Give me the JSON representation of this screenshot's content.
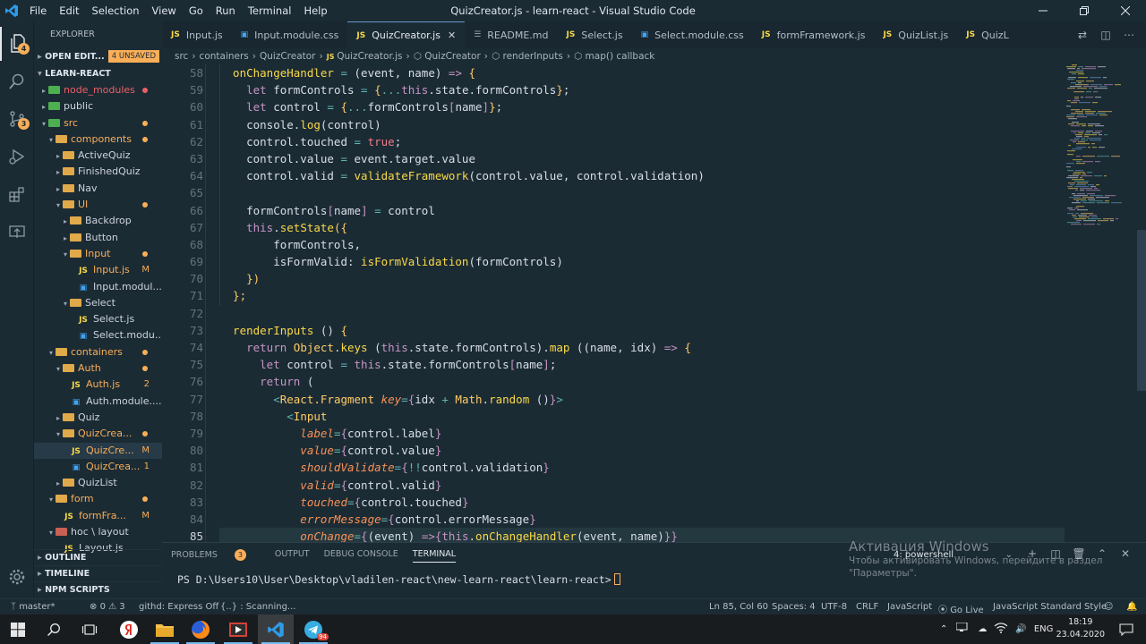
{
  "window": {
    "title": "QuizCreator.js - learn-react - Visual Studio Code",
    "menu": [
      "File",
      "Edit",
      "Selection",
      "View",
      "Go",
      "Run",
      "Terminal",
      "Help"
    ]
  },
  "activity": {
    "explorer_badge": "4",
    "scm_badge": "3"
  },
  "sidebar": {
    "header": "EXPLORER",
    "open_editors": "OPEN EDIT...",
    "unsaved": "4 UNSAVED",
    "project": "LEARN-REACT",
    "tree": [
      {
        "label": "node_modules",
        "depth": 1,
        "kind": "folder-green",
        "open": false,
        "color": "red",
        "dot": "red"
      },
      {
        "label": "public",
        "depth": 1,
        "kind": "folder-green",
        "open": false,
        "color": "plain",
        "dot": ""
      },
      {
        "label": "src",
        "depth": 1,
        "kind": "folder-green",
        "open": true,
        "color": "orange",
        "dot": "orange"
      },
      {
        "label": "components",
        "depth": 2,
        "kind": "folder",
        "open": true,
        "color": "orange",
        "dot": "orange"
      },
      {
        "label": "ActiveQuiz",
        "depth": 3,
        "kind": "folder",
        "open": false,
        "color": "plain",
        "dot": ""
      },
      {
        "label": "FinishedQuiz",
        "depth": 3,
        "kind": "folder",
        "open": false,
        "color": "plain",
        "dot": ""
      },
      {
        "label": "Nav",
        "depth": 3,
        "kind": "folder",
        "open": false,
        "color": "plain",
        "dot": ""
      },
      {
        "label": "UI",
        "depth": 3,
        "kind": "folder",
        "open": true,
        "color": "orange",
        "dot": "orange"
      },
      {
        "label": "Backdrop",
        "depth": 4,
        "kind": "folder",
        "open": false,
        "color": "plain",
        "dot": ""
      },
      {
        "label": "Button",
        "depth": 4,
        "kind": "folder",
        "open": false,
        "color": "plain",
        "dot": ""
      },
      {
        "label": "Input",
        "depth": 4,
        "kind": "folder",
        "open": true,
        "color": "orange",
        "dot": "orange"
      },
      {
        "label": "Input.js",
        "depth": 5,
        "kind": "js",
        "open": false,
        "color": "orange",
        "status": "M"
      },
      {
        "label": "Input.modul...",
        "depth": 5,
        "kind": "css",
        "open": false,
        "color": "plain",
        "dot": ""
      },
      {
        "label": "Select",
        "depth": 4,
        "kind": "folder",
        "open": true,
        "color": "plain",
        "dot": ""
      },
      {
        "label": "Select.js",
        "depth": 5,
        "kind": "js",
        "open": false,
        "color": "plain",
        "dot": ""
      },
      {
        "label": "Select.modu...",
        "depth": 5,
        "kind": "css",
        "open": false,
        "color": "plain",
        "dot": ""
      },
      {
        "label": "containers",
        "depth": 2,
        "kind": "folder",
        "open": true,
        "color": "orange",
        "dot": "orange"
      },
      {
        "label": "Auth",
        "depth": 3,
        "kind": "folder",
        "open": true,
        "color": "orange",
        "dot": "orange"
      },
      {
        "label": "Auth.js",
        "depth": 4,
        "kind": "js",
        "open": false,
        "color": "orange",
        "status": "2"
      },
      {
        "label": "Auth.module....",
        "depth": 4,
        "kind": "css",
        "open": false,
        "color": "plain",
        "dot": ""
      },
      {
        "label": "Quiz",
        "depth": 3,
        "kind": "folder",
        "open": false,
        "color": "plain",
        "dot": ""
      },
      {
        "label": "QuizCrea...",
        "depth": 3,
        "kind": "folder",
        "open": true,
        "color": "orange",
        "dot": "orange"
      },
      {
        "label": "QuizCre...",
        "depth": 4,
        "kind": "js",
        "open": false,
        "color": "orange",
        "status": "M",
        "selected": true
      },
      {
        "label": "QuizCrea...",
        "depth": 4,
        "kind": "css",
        "open": false,
        "color": "orange",
        "status": "1"
      },
      {
        "label": "QuizList",
        "depth": 3,
        "kind": "folder",
        "open": false,
        "color": "plain",
        "dot": ""
      },
      {
        "label": "form",
        "depth": 2,
        "kind": "folder",
        "open": true,
        "color": "orange",
        "dot": "orange"
      },
      {
        "label": "formFra...",
        "depth": 3,
        "kind": "js",
        "open": false,
        "color": "orange",
        "status": "M"
      },
      {
        "label": "hoc \\ layout",
        "depth": 2,
        "kind": "folder-red",
        "open": true,
        "color": "plain",
        "dot": ""
      },
      {
        "label": "Layout.js",
        "depth": 3,
        "kind": "js",
        "open": false,
        "color": "plain",
        "dot": ""
      }
    ],
    "bottom_sections": [
      "OUTLINE",
      "TIMELINE",
      "NPM SCRIPTS"
    ]
  },
  "tabs": [
    {
      "label": "Input.js",
      "kind": "js",
      "active": false
    },
    {
      "label": "Input.module.css",
      "kind": "css",
      "active": false
    },
    {
      "label": "QuizCreator.js",
      "kind": "js",
      "active": true
    },
    {
      "label": "README.md",
      "kind": "md",
      "active": false
    },
    {
      "label": "Select.js",
      "kind": "js",
      "active": false
    },
    {
      "label": "Select.module.css",
      "kind": "css",
      "active": false
    },
    {
      "label": "formFramework.js",
      "kind": "js",
      "active": false
    },
    {
      "label": "QuizList.js",
      "kind": "js",
      "active": false
    },
    {
      "label": "QuizL",
      "kind": "js",
      "active": false
    }
  ],
  "breadcrumb": [
    "src",
    "containers",
    "QuizCreator",
    "QuizCreator.js",
    "QuizCreator",
    "renderInputs",
    "map() callback"
  ],
  "code": {
    "current_line": 85,
    "lines": [
      {
        "n": 58,
        "t": [
          [
            "  onChangeHandler",
            "y"
          ],
          [
            " = ",
            "p"
          ],
          [
            "(",
            "w"
          ],
          [
            "event",
            "w"
          ],
          [
            ", ",
            "w"
          ],
          [
            "name",
            "w"
          ],
          [
            ")",
            "w"
          ],
          [
            " => ",
            "k"
          ],
          [
            "{",
            "o"
          ]
        ]
      },
      {
        "n": 59,
        "t": [
          [
            "    let ",
            "k"
          ],
          [
            "formControls",
            "w"
          ],
          [
            " = ",
            "p"
          ],
          [
            "{",
            "o"
          ],
          [
            "...",
            "p"
          ],
          [
            "this",
            "k"
          ],
          [
            ".state.formControls",
            "w"
          ],
          [
            "}",
            "o"
          ],
          [
            ";",
            "w"
          ]
        ]
      },
      {
        "n": 60,
        "t": [
          [
            "    let ",
            "k"
          ],
          [
            "control",
            "w"
          ],
          [
            " = ",
            "p"
          ],
          [
            "{",
            "o"
          ],
          [
            "...",
            "p"
          ],
          [
            "formControls",
            "w"
          ],
          [
            "[",
            "k"
          ],
          [
            "name",
            "w"
          ],
          [
            "]",
            "k"
          ],
          [
            "}",
            "o"
          ],
          [
            ";",
            "w"
          ]
        ]
      },
      {
        "n": 61,
        "t": [
          [
            "    console",
            "w"
          ],
          [
            ".",
            "w"
          ],
          [
            "log",
            "y"
          ],
          [
            "(",
            "w"
          ],
          [
            "control",
            "w"
          ],
          [
            ")",
            "w"
          ]
        ]
      },
      {
        "n": 62,
        "t": [
          [
            "    control.touched",
            "w"
          ],
          [
            " = ",
            "p"
          ],
          [
            "true",
            "b"
          ],
          [
            ";",
            "w"
          ]
        ]
      },
      {
        "n": 63,
        "t": [
          [
            "    control.value",
            "w"
          ],
          [
            " = ",
            "p"
          ],
          [
            "event.target.value",
            "w"
          ]
        ]
      },
      {
        "n": 64,
        "t": [
          [
            "    control.valid",
            "w"
          ],
          [
            " = ",
            "p"
          ],
          [
            "validateFramework",
            "y"
          ],
          [
            "(",
            "w"
          ],
          [
            "control.value, control.validation",
            "w"
          ],
          [
            ")",
            "w"
          ]
        ]
      },
      {
        "n": 65,
        "t": []
      },
      {
        "n": 66,
        "t": [
          [
            "    formControls",
            "w"
          ],
          [
            "[",
            "k"
          ],
          [
            "name",
            "w"
          ],
          [
            "]",
            "k"
          ],
          [
            " = ",
            "p"
          ],
          [
            "control",
            "w"
          ]
        ]
      },
      {
        "n": 67,
        "t": [
          [
            "    this",
            "k"
          ],
          [
            ".",
            "w"
          ],
          [
            "setState",
            "y"
          ],
          [
            "({",
            "o"
          ]
        ]
      },
      {
        "n": 68,
        "t": [
          [
            "        formControls,",
            "w"
          ]
        ]
      },
      {
        "n": 69,
        "t": [
          [
            "        isFormValid: ",
            "w"
          ],
          [
            "isFormValidation",
            "y"
          ],
          [
            "(",
            "w"
          ],
          [
            "formControls",
            "w"
          ],
          [
            ")",
            "w"
          ]
        ]
      },
      {
        "n": 70,
        "t": [
          [
            "    })",
            "o"
          ]
        ]
      },
      {
        "n": 71,
        "t": [
          [
            "  };",
            "o"
          ]
        ]
      },
      {
        "n": 72,
        "t": []
      },
      {
        "n": 73,
        "t": [
          [
            "  renderInputs",
            "y"
          ],
          [
            " () ",
            "w"
          ],
          [
            "{",
            "o"
          ]
        ]
      },
      {
        "n": 74,
        "t": [
          [
            "    return ",
            "k"
          ],
          [
            "Object",
            "o"
          ],
          [
            ".",
            "w"
          ],
          [
            "keys",
            "y"
          ],
          [
            " (",
            "w"
          ],
          [
            "this",
            "k"
          ],
          [
            ".state.formControls",
            ""
          ],
          [
            ").",
            "w"
          ],
          [
            "map",
            "y"
          ],
          [
            " ((",
            "w"
          ],
          [
            "name, idx",
            "w"
          ],
          [
            ") ",
            "w"
          ],
          [
            "=> ",
            "k"
          ],
          [
            "{",
            "o"
          ]
        ]
      },
      {
        "n": 75,
        "t": [
          [
            "      let ",
            "k"
          ],
          [
            "control",
            "w"
          ],
          [
            " = ",
            "p"
          ],
          [
            "this",
            "k"
          ],
          [
            ".state.formControls",
            "w"
          ],
          [
            "[",
            "k"
          ],
          [
            "name",
            "w"
          ],
          [
            "]",
            "k"
          ],
          [
            ";",
            "w"
          ]
        ]
      },
      {
        "n": 76,
        "t": [
          [
            "      return ",
            "k"
          ],
          [
            "(",
            "w"
          ]
        ]
      },
      {
        "n": 77,
        "t": [
          [
            "        <",
            "p"
          ],
          [
            "React.Fragment",
            "o"
          ],
          [
            " key",
            "a"
          ],
          [
            "=",
            "p"
          ],
          [
            "{",
            "k"
          ],
          [
            "idx",
            "w"
          ],
          [
            " + ",
            "p"
          ],
          [
            "Math",
            "o"
          ],
          [
            ".",
            "w"
          ],
          [
            "random",
            "y"
          ],
          [
            " ()",
            "w"
          ],
          [
            "}",
            "k"
          ],
          [
            ">",
            "p"
          ]
        ]
      },
      {
        "n": 78,
        "t": [
          [
            "          <",
            "p"
          ],
          [
            "Input",
            "o"
          ]
        ]
      },
      {
        "n": 79,
        "t": [
          [
            "            label",
            "a"
          ],
          [
            "=",
            "p"
          ],
          [
            "{",
            "k"
          ],
          [
            "control.label",
            "w"
          ],
          [
            "}",
            "k"
          ]
        ]
      },
      {
        "n": 80,
        "t": [
          [
            "            value",
            "a"
          ],
          [
            "=",
            "p"
          ],
          [
            "{",
            "k"
          ],
          [
            "control.value",
            "w"
          ],
          [
            "}",
            "k"
          ]
        ]
      },
      {
        "n": 81,
        "t": [
          [
            "            shouldValidate",
            "a"
          ],
          [
            "=",
            "p"
          ],
          [
            "{",
            "k"
          ],
          [
            "!!",
            "p"
          ],
          [
            "control.validation",
            "w"
          ],
          [
            "}",
            "k"
          ]
        ]
      },
      {
        "n": 82,
        "t": [
          [
            "            valid",
            "a"
          ],
          [
            "=",
            "p"
          ],
          [
            "{",
            "k"
          ],
          [
            "control.valid",
            "w"
          ],
          [
            "}",
            "k"
          ]
        ]
      },
      {
        "n": 83,
        "t": [
          [
            "            touched",
            "a"
          ],
          [
            "=",
            "p"
          ],
          [
            "{",
            "k"
          ],
          [
            "control.touched",
            "w"
          ],
          [
            "}",
            "k"
          ]
        ]
      },
      {
        "n": 84,
        "t": [
          [
            "            errorMessage",
            "a"
          ],
          [
            "=",
            "p"
          ],
          [
            "{",
            "k"
          ],
          [
            "control.errorMessage",
            "w"
          ],
          [
            "}",
            "k"
          ]
        ]
      },
      {
        "n": 85,
        "t": [
          [
            "            onChange",
            "a"
          ],
          [
            "=",
            "p"
          ],
          [
            "{",
            "k"
          ],
          [
            "(",
            "w"
          ],
          [
            "event",
            "w"
          ],
          [
            ") ",
            "w"
          ],
          [
            "=>",
            "k"
          ],
          [
            "{",
            "k"
          ],
          [
            "this",
            "k"
          ],
          [
            ".",
            "w"
          ],
          [
            "onChangeHandler",
            "y"
          ],
          [
            "(",
            "w"
          ],
          [
            "event, name",
            "w"
          ],
          [
            ")",
            "w"
          ],
          [
            "}",
            "k"
          ],
          [
            "}",
            "k"
          ]
        ]
      }
    ]
  },
  "panel": {
    "tabs": [
      "PROBLEMS",
      "OUTPUT",
      "DEBUG CONSOLE",
      "TERMINAL"
    ],
    "problems_count": "3",
    "active_tab": "TERMINAL",
    "shell": "4: powershell",
    "prompt": "PS D:\\Users10\\User\\Desktop\\vladilen-react\\new-learn-react\\learn-react>"
  },
  "watermark": {
    "line1": "Активация Windows",
    "line2": "Чтобы активировать Windows, перейдите в раздел",
    "line3": "\"Параметры\"."
  },
  "statusbar": {
    "branch": "master*",
    "errors": "0",
    "warnings": "3",
    "githd": "githd: Express Off",
    "scanning": "{..} : Scanning...",
    "position": "Ln 85, Col 60",
    "spaces": "Spaces: 4",
    "encoding": "UTF-8",
    "eol": "CRLF",
    "language": "JavaScript",
    "golive": "Go Live",
    "linter": "JavaScript Standard Style"
  },
  "taskbar": {
    "lang": "ENG",
    "time": "18:19",
    "date": "23.04.2020",
    "telegram_badge": "94"
  }
}
